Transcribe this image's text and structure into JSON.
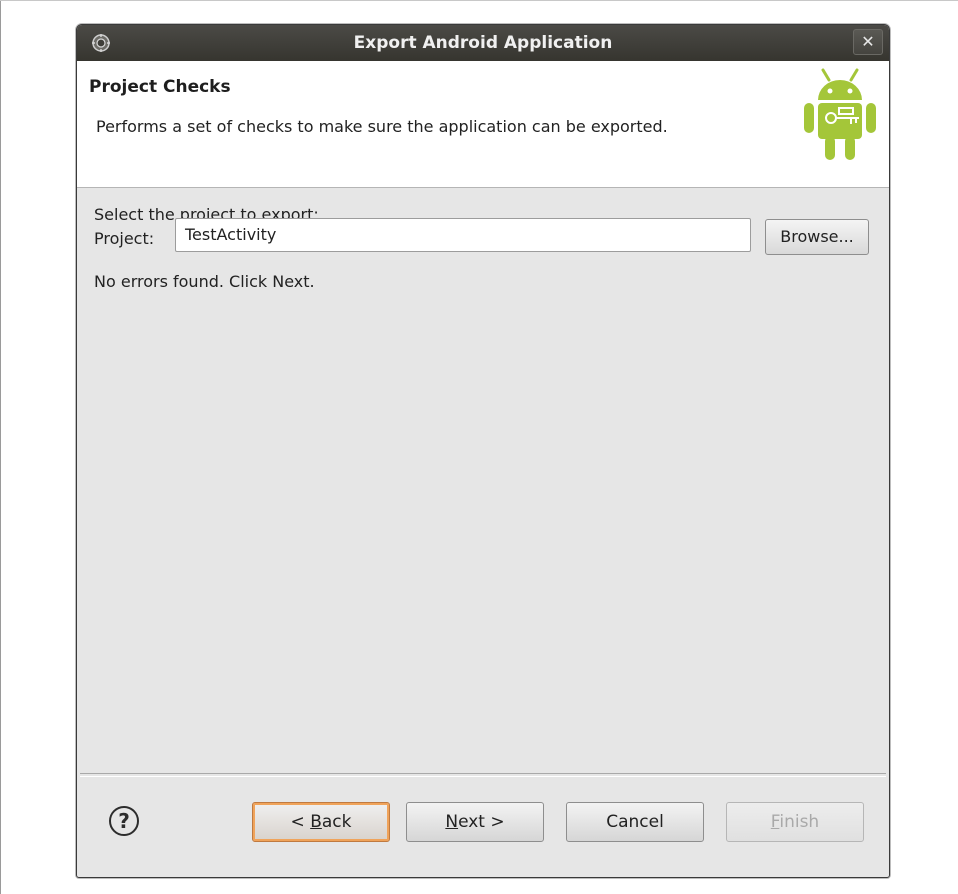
{
  "window": {
    "title": "Export Android Application",
    "close_glyph": "✕"
  },
  "banner": {
    "heading": "Project Checks",
    "description": "Performs a set of checks to make sure the application can be exported.",
    "logo_icon": "android-logo-icon"
  },
  "content": {
    "select_label": "Select the project to export:",
    "project_label": "Project:",
    "project_value": "TestActivity",
    "browse_label": "Browse...",
    "status": "No errors found. Click Next."
  },
  "footer": {
    "help_glyph": "?",
    "back": {
      "prefix": "< ",
      "mnemonic": "B",
      "rest": "ack"
    },
    "next": {
      "prefix": "",
      "mnemonic": "N",
      "rest": "ext >"
    },
    "cancel_label": "Cancel",
    "finish": {
      "prefix": "",
      "mnemonic": "F",
      "rest": "inish"
    }
  },
  "colors": {
    "titlebar": "#3f3e39",
    "dialog_bg": "#e6e6e6",
    "focus_accent": "#f0a35a",
    "android_green": "#a4c639"
  }
}
